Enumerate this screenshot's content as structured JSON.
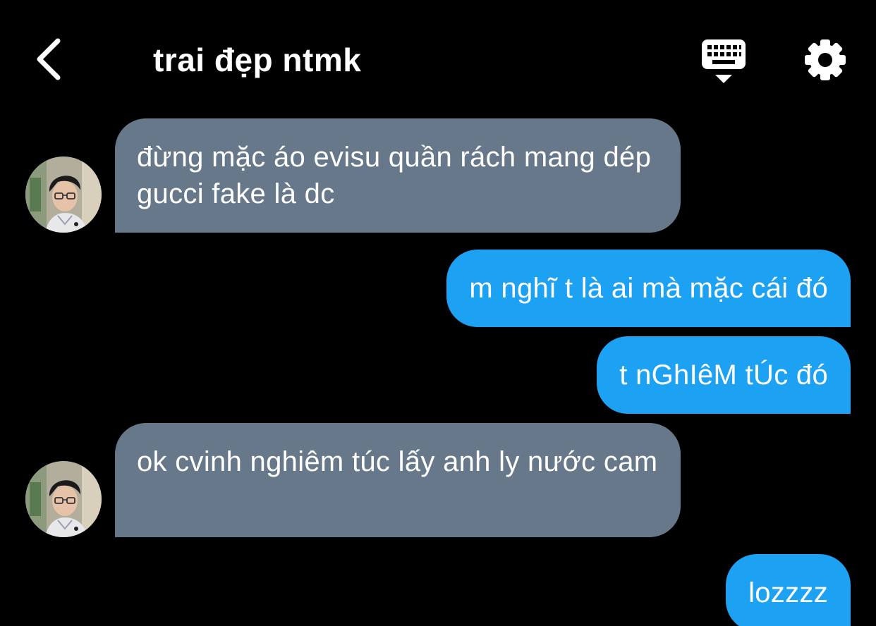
{
  "header": {
    "title": "trai đẹp ntmk",
    "back_icon": "chevron-left-icon",
    "keyboard_icon": "keyboard-hide-icon",
    "settings_icon": "gear-icon"
  },
  "messages": [
    {
      "direction": "received",
      "text": "đừng mặc áo evisu quần rách mang dép gucci fake là dc"
    },
    {
      "direction": "sent",
      "text": "m nghĩ t là ai mà mặc cái đó"
    },
    {
      "direction": "sent",
      "text": "t nGhIêM tÚc đó"
    },
    {
      "direction": "received",
      "text": "ok cvinh nghiêm túc lấy anh ly nước cam"
    },
    {
      "direction": "sent",
      "text": "lozzzz"
    }
  ],
  "colors": {
    "background": "#000000",
    "received_bubble": "#66788a",
    "sent_bubble": "#1da1f2",
    "text": "#ffffff"
  }
}
